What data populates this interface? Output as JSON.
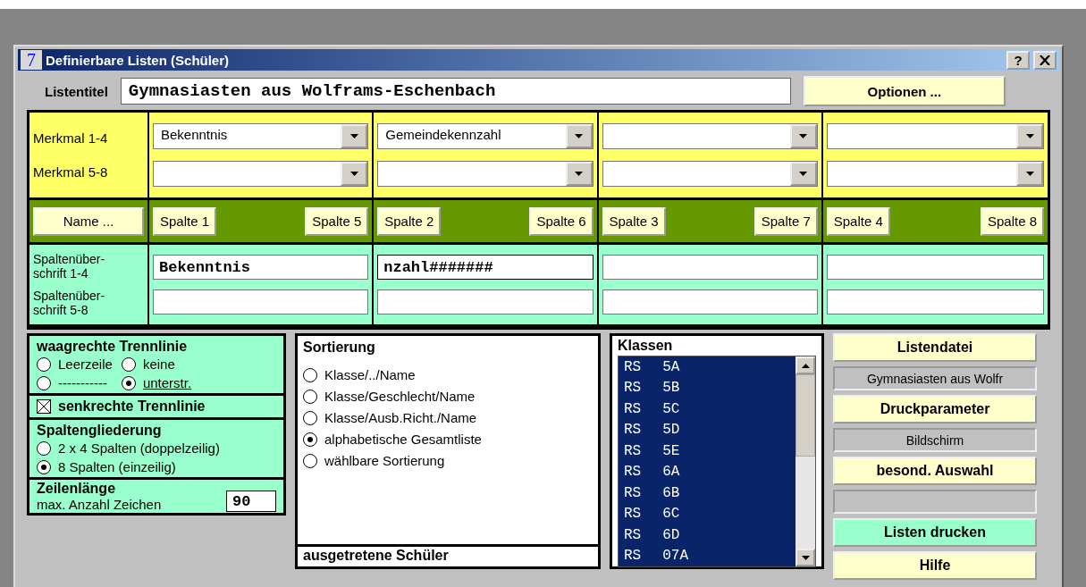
{
  "window": {
    "title": "Definierbare Listen (Schüler)",
    "icon_text": "7",
    "help": "?"
  },
  "list_title": {
    "label": "Listentitel",
    "value": "Gymnasiasten aus Wolframs-Eschenbach"
  },
  "options_button": "Optionen ...",
  "merkmal": {
    "labels": [
      "Merkmal 1-4",
      "Merkmal 5-8"
    ],
    "rows": [
      [
        {
          "value": "Bekenntnis"
        },
        {
          "value": "Gemeindekennzahl"
        },
        {},
        {}
      ],
      [
        {},
        {},
        {},
        {}
      ]
    ]
  },
  "name_button": "Name ...",
  "column_buttons": [
    [
      "Spalte 1",
      "Spalte 5"
    ],
    [
      "Spalte 2",
      "Spalte 6"
    ],
    [
      "Spalte 3",
      "Spalte 7"
    ],
    [
      "Spalte 4",
      "Spalte 8"
    ]
  ],
  "headings": {
    "labels": [
      "Spaltenüber-schrift 1-4",
      "Spaltenüber-schrift 5-8"
    ],
    "rows": [
      [
        {
          "value": "Bekenntnis"
        },
        {
          "value": "nzahl#######",
          "focused": true
        },
        {},
        {}
      ],
      [
        {},
        {},
        {},
        {}
      ]
    ]
  },
  "horizontal_line": {
    "title": "waagrechte Trennlinie",
    "options": [
      {
        "label": "Leerzeile",
        "selected": false
      },
      {
        "label": "keine",
        "selected": false
      },
      {
        "label": "-----------",
        "selected": false
      },
      {
        "label": "unterstr.",
        "selected": true,
        "underlined": true
      }
    ]
  },
  "vertical_line": {
    "label": "senkrechte Trennlinie",
    "checked": true
  },
  "column_layout": {
    "title": "Spaltengliederung",
    "options": [
      {
        "label": "2 x 4 Spalten (doppelzeilig)",
        "selected": false
      },
      {
        "label": "8 Spalten (einzeilig)",
        "selected": true
      }
    ]
  },
  "line_length": {
    "title": "Zeilenlänge",
    "label": "max. Anzahl Zeichen",
    "value": "90"
  },
  "sorting": {
    "title": "Sortierung",
    "options": [
      {
        "label": "Klasse/../Name",
        "selected": false
      },
      {
        "label": "Klasse/Geschlecht/Name",
        "selected": false
      },
      {
        "label": "Klasse/Ausb.Richt./Name",
        "selected": false
      },
      {
        "label": "alphabetische Gesamtliste",
        "selected": true
      },
      {
        "label": "wählbare Sortierung",
        "selected": false
      }
    ]
  },
  "excluded": {
    "title": "ausgetretene Schüler"
  },
  "classes": {
    "title": "Klassen",
    "items": [
      {
        "school": "RS",
        "class": "5A",
        "selected": true
      },
      {
        "school": "RS",
        "class": "5B",
        "selected": true
      },
      {
        "school": "RS",
        "class": "5C",
        "selected": true
      },
      {
        "school": "RS",
        "class": "5D",
        "selected": true
      },
      {
        "school": "RS",
        "class": "5E",
        "selected": true
      },
      {
        "school": "RS",
        "class": "6A",
        "selected": true
      },
      {
        "school": "RS",
        "class": "6B",
        "selected": true
      },
      {
        "school": "RS",
        "class": "6C",
        "selected": true
      },
      {
        "school": "RS",
        "class": "6D",
        "selected": true
      },
      {
        "school": "RS",
        "class": "07A",
        "selected": true
      }
    ]
  },
  "side": [
    {
      "kind": "button",
      "label": "Listendatei"
    },
    {
      "kind": "display",
      "value": "Gymnasiasten aus Wolfr"
    },
    {
      "kind": "button",
      "label": "Druckparameter"
    },
    {
      "kind": "display",
      "value": "Bildschirm"
    },
    {
      "kind": "button",
      "label": "besond. Auswahl"
    },
    {
      "kind": "display"
    },
    {
      "kind": "primary",
      "label": "Listen drucken"
    },
    {
      "kind": "button",
      "label": "Hilfe"
    }
  ]
}
